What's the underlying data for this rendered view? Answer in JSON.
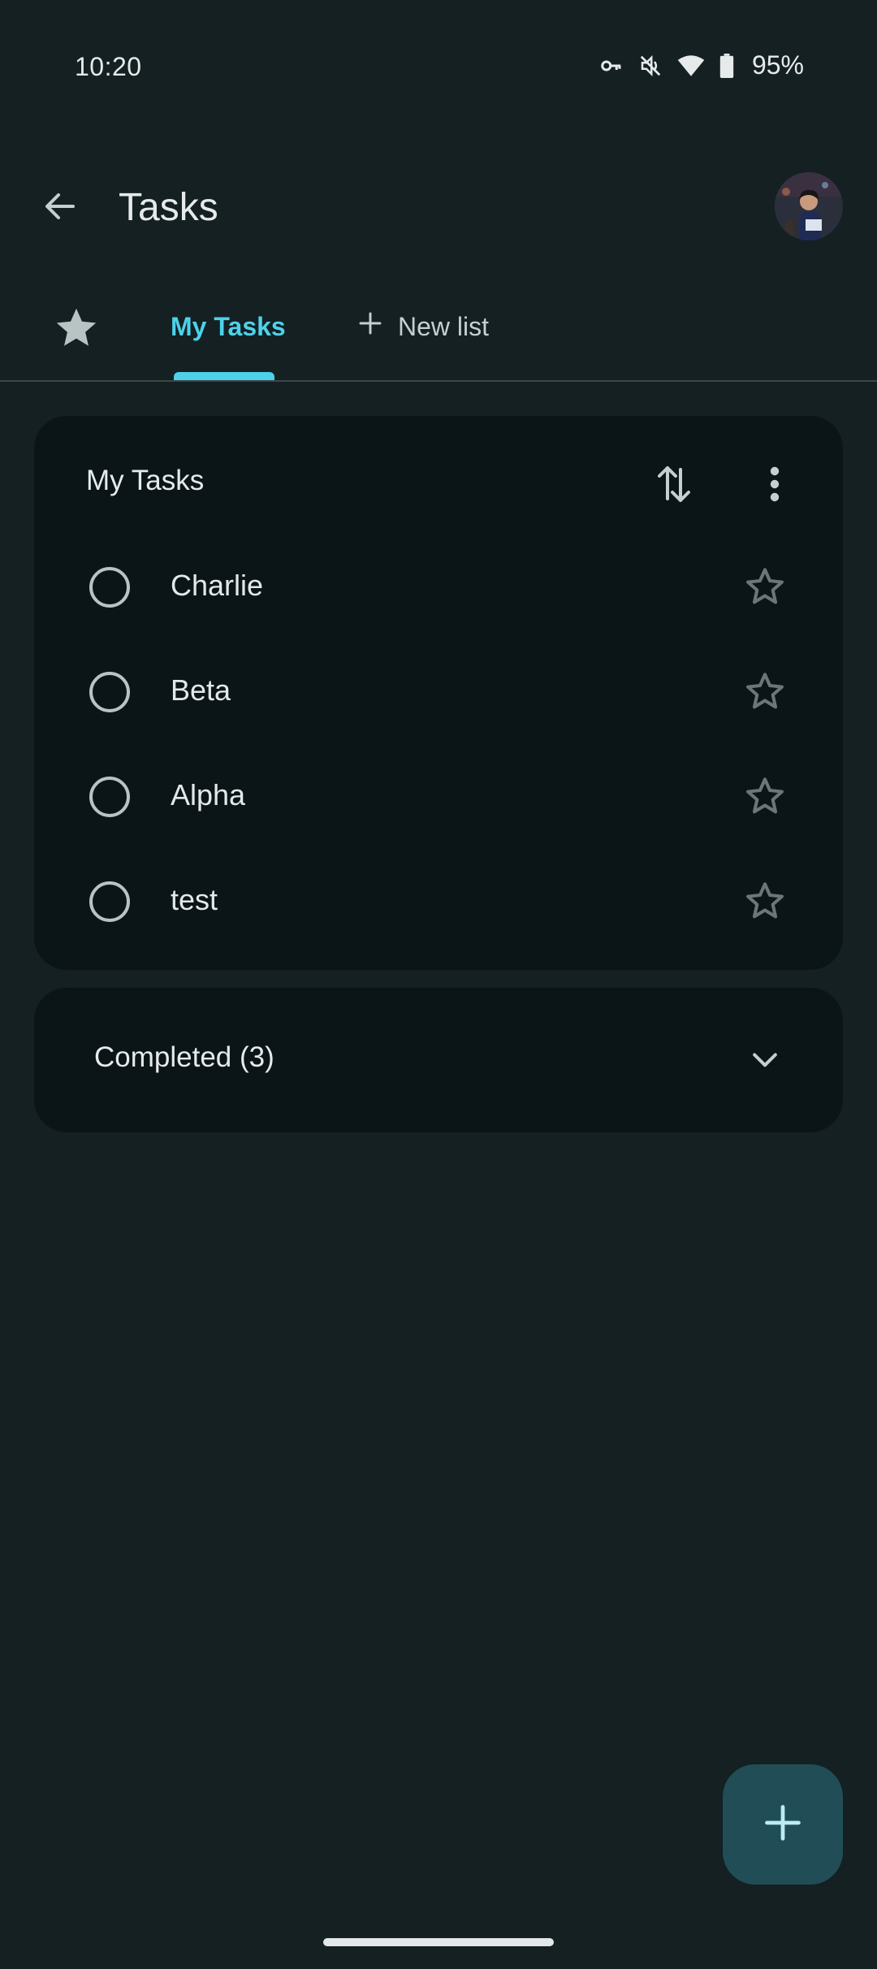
{
  "status_bar": {
    "time": "10:20",
    "battery_percent": "95%",
    "icons": [
      "vpn-key-icon",
      "vibrate-off-icon",
      "wifi-icon",
      "battery-icon"
    ]
  },
  "app_bar": {
    "title": "Tasks",
    "back_icon": "arrow-back-icon",
    "avatar": "account-avatar"
  },
  "tabs": {
    "starred_icon": "star-filled-icon",
    "items": [
      {
        "label": "My Tasks",
        "selected": true
      },
      {
        "label": "New list",
        "icon": "plus-icon",
        "selected": false
      }
    ]
  },
  "task_list": {
    "title": "My Tasks",
    "sort_icon": "sort-arrows-icon",
    "more_icon": "more-vert-icon",
    "tasks": [
      {
        "label": "Charlie",
        "starred": false
      },
      {
        "label": "Beta",
        "starred": false
      },
      {
        "label": "Alpha",
        "starred": false
      },
      {
        "label": "test",
        "starred": false
      }
    ]
  },
  "completed": {
    "label": "Completed (3)",
    "icon": "chevron-down-icon"
  },
  "fab": {
    "icon": "plus-icon"
  },
  "colors": {
    "background": "#142022",
    "card": "#0b1517",
    "accent": "#4dd2e9",
    "fab": "#214d56"
  }
}
